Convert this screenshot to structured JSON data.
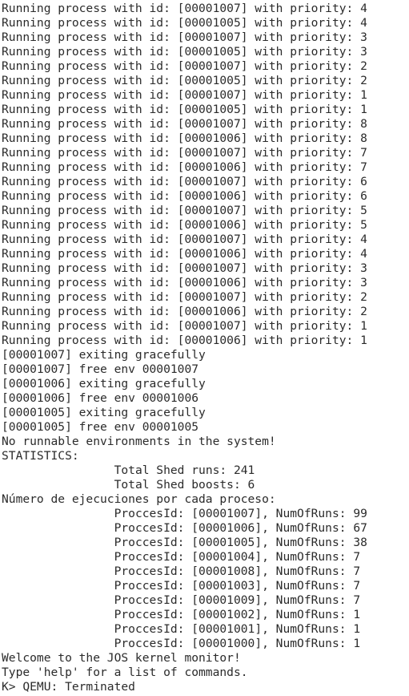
{
  "terminal": {
    "lines": [
      "Running process with id: [00001007] with priority: 4",
      "Running process with id: [00001005] with priority: 4",
      "Running process with id: [00001007] with priority: 3",
      "Running process with id: [00001005] with priority: 3",
      "Running process with id: [00001007] with priority: 2",
      "Running process with id: [00001005] with priority: 2",
      "Running process with id: [00001007] with priority: 1",
      "Running process with id: [00001005] with priority: 1",
      "Running process with id: [00001007] with priority: 8",
      "Running process with id: [00001006] with priority: 8",
      "Running process with id: [00001007] with priority: 7",
      "Running process with id: [00001006] with priority: 7",
      "Running process with id: [00001007] with priority: 6",
      "Running process with id: [00001006] with priority: 6",
      "Running process with id: [00001007] with priority: 5",
      "Running process with id: [00001006] with priority: 5",
      "Running process with id: [00001007] with priority: 4",
      "Running process with id: [00001006] with priority: 4",
      "Running process with id: [00001007] with priority: 3",
      "Running process with id: [00001006] with priority: 3",
      "Running process with id: [00001007] with priority: 2",
      "Running process with id: [00001006] with priority: 2",
      "Running process with id: [00001007] with priority: 1",
      "Running process with id: [00001006] with priority: 1",
      "[00001007] exiting gracefully",
      "[00001007] free env 00001007",
      "[00001006] exiting gracefully",
      "[00001006] free env 00001006",
      "[00001005] exiting gracefully",
      "[00001005] free env 00001005",
      "No runnable environments in the system!",
      "STATISTICS:",
      "\t\tTotal Shed runs: 241",
      "\t\tTotal Shed boosts: 6",
      "Número de ejecuciones por cada proceso:",
      "\t\tProccesId: [00001007], NumOfRuns: 99",
      "\t\tProccesId: [00001006], NumOfRuns: 67",
      "\t\tProccesId: [00001005], NumOfRuns: 38",
      "\t\tProccesId: [00001004], NumOfRuns: 7",
      "\t\tProccesId: [00001008], NumOfRuns: 7",
      "\t\tProccesId: [00001003], NumOfRuns: 7",
      "\t\tProccesId: [00001009], NumOfRuns: 7",
      "\t\tProccesId: [00001002], NumOfRuns: 1",
      "\t\tProccesId: [00001001], NumOfRuns: 1",
      "\t\tProccesId: [00001000], NumOfRuns: 1",
      "Welcome to the JOS kernel monitor!",
      "Type 'help' for a list of commands.",
      "K> QEMU: Terminated"
    ]
  }
}
